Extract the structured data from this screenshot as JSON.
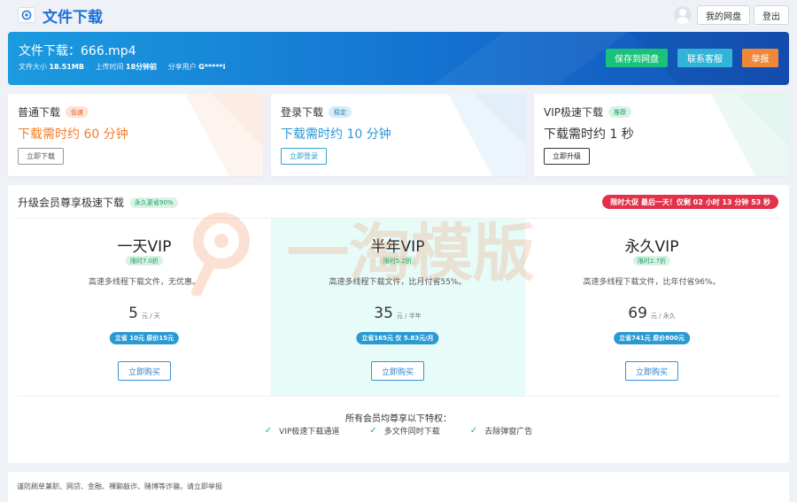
{
  "header": {
    "site_title": "文件下载",
    "logo_icon": "cloud-logo-icon",
    "my_disk": "我的网盘",
    "logout": "登出"
  },
  "file": {
    "title": "文件下载：666.mp4",
    "size_label": "文件大小",
    "size_value": "18.51MB",
    "upload_label": "上传时间",
    "upload_value": "18分钟前",
    "sharer_label": "分享用户",
    "sharer_value": "G*****i",
    "save_btn": "保存到网盘",
    "contact_btn": "联系客服",
    "report_btn": "举报"
  },
  "download_options": [
    {
      "title": "普通下载",
      "badge": "低速",
      "time": "下载需时约 60 分钟",
      "button": "立即下载"
    },
    {
      "title": "登录下载",
      "badge": "稳定",
      "time": "下载需时约 10 分钟",
      "button": "立即登录"
    },
    {
      "title": "VIP极速下载",
      "badge": "推荐",
      "time": "下载需时约 1 秒",
      "button": "立即升级"
    }
  ],
  "vip": {
    "heading": "升级会员尊享极速下载",
    "heading_badge": "永久更省90%",
    "promo": "限时大促 最后一天！仅剩 02 小时 13 分钟 53 秒",
    "watermark": "一淘模版",
    "plans": [
      {
        "name": "一天VIP",
        "discount": "限时7.0折",
        "desc": "高速多线程下载文件，无优惠。",
        "price": "5",
        "unit": "元 / 天",
        "save": "立省 10元 原价15元",
        "buy": "立即购买"
      },
      {
        "name": "半年VIP",
        "discount": "限时5.2折",
        "desc": "高速多线程下载文件，比月付省55%。",
        "price": "35",
        "unit": "元 / 半年",
        "save": "立省165元 仅 5.83元/月",
        "buy": "立即购买"
      },
      {
        "name": "永久VIP",
        "discount": "限时2.7折",
        "desc": "高速多线程下载文件，比年付省96%。",
        "price": "69",
        "unit": "元 / 永久",
        "save": "立省741元 原价800元",
        "buy": "立即购买"
      }
    ],
    "benefits_title": "所有会员均尊享以下特权：",
    "benefits": [
      "VIP极速下载通道",
      "多文件同时下载",
      "去除弹窗广告"
    ]
  },
  "footer": {
    "text": "谨防刷单兼职、网贷、金融、裸聊敲诈、赌博等诈骗，请立即举报"
  },
  "colors": {
    "brand": "#1e6fd9",
    "banner_start": "#1b9be0",
    "banner_end": "#1550b8",
    "save_green": "#19c27a",
    "contact_cyan": "#31b4d8",
    "report_orange": "#f07e2a",
    "promo_red": "#e3314a",
    "check_green": "#18b96e"
  }
}
